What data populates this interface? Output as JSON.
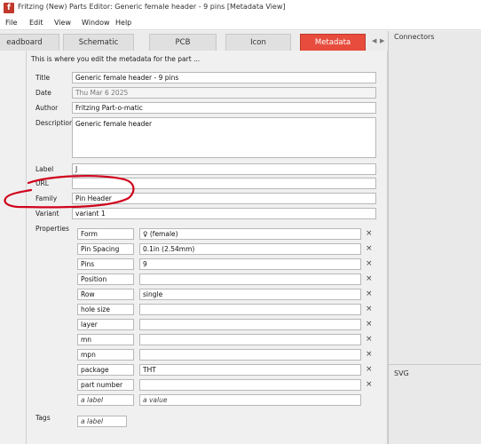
{
  "window": {
    "title": "Fritzing (New) Parts Editor: Generic female header - 9 pins [Metadata View]",
    "app_icon": "f"
  },
  "menu": [
    "File",
    "Edit",
    "View",
    "Window",
    "Help"
  ],
  "tabs": [
    {
      "label": "eadboard",
      "active": false
    },
    {
      "label": "Schematic",
      "active": false
    },
    {
      "label": "PCB",
      "active": false
    },
    {
      "label": "Icon",
      "active": false
    },
    {
      "label": "Metadata",
      "active": true
    }
  ],
  "tab_scroll": {
    "left": "◀",
    "right": "▶"
  },
  "metadata": {
    "intro": "This is where you edit the metadata for the part ...",
    "title_label": "Title",
    "title_value": "Generic female header - 9 pins",
    "date_label": "Date",
    "date_value": "Thu Mar 6 2025",
    "author_label": "Author",
    "author_value": "Fritzing Part-o-matic",
    "description_label": "Description",
    "description_value": "Generic female header",
    "label_label": "Label",
    "label_value": "J",
    "url_label": "URL",
    "url_value": "",
    "family_label": "Family",
    "family_value": "Pin Header",
    "variant_label": "Variant",
    "variant_value": "variant 1",
    "properties_label": "Properties",
    "properties": [
      {
        "name": "Form",
        "value": "♀ (female)"
      },
      {
        "name": "Pin Spacing",
        "value": "0.1in (2.54mm)"
      },
      {
        "name": "Pins",
        "value": "9"
      },
      {
        "name": "Position",
        "value": ""
      },
      {
        "name": "Row",
        "value": "single"
      },
      {
        "name": "hole size",
        "value": ""
      },
      {
        "name": "layer",
        "value": ""
      },
      {
        "name": "mn",
        "value": ""
      },
      {
        "name": "mpn",
        "value": ""
      },
      {
        "name": "package",
        "value": "THT"
      },
      {
        "name": "part number",
        "value": ""
      }
    ],
    "new_property_name_placeholder": "a label",
    "new_property_value_placeholder": "a value",
    "remove_symbol": "×",
    "tags_label": "Tags",
    "tags_placeholder": "a label"
  },
  "docks": {
    "connectors_title": "Connectors",
    "svg_title": "SVG"
  },
  "colors": {
    "active_tab": "#e74c3c",
    "annotation": "#d0021b"
  }
}
